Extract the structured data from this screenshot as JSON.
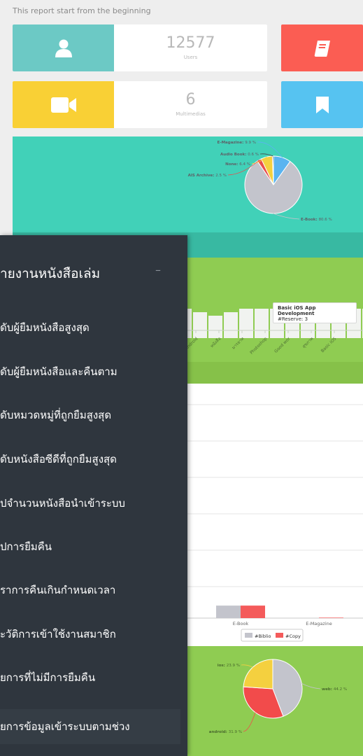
{
  "report": {
    "subtitle": "This report start from the beginning"
  },
  "stats": [
    {
      "value": "12577",
      "label": "Users",
      "icon": "user-icon",
      "color": "#6cc9c5"
    },
    {
      "value": "",
      "label": "",
      "icon": "book-icon",
      "color": "#fb5d53"
    },
    {
      "value": "6",
      "label": "Multimedias",
      "icon": "video-camera-icon",
      "color": "#f9d035"
    },
    {
      "value": "",
      "label": "",
      "icon": "bookmark-icon",
      "color": "#56c3f1"
    }
  ],
  "chart_data": [
    {
      "type": "pie",
      "categories": [
        "E-Book",
        "E-Magazine",
        "Audio Book",
        "None",
        "AIS Archive"
      ],
      "values": [
        80.6,
        9.9,
        0.6,
        6.4,
        2.5
      ],
      "labels": [
        "E-Book: 80.6 %",
        "E-Magazine: 9.9 %",
        "Audio Book: 0.6 %",
        "None: 6.4 %",
        "AIS Archive: 2.5 %"
      ],
      "colors": [
        "#c3c4cc",
        "#5ab4f0",
        "#444444",
        "#f4d03f",
        "#e84d4d"
      ]
    },
    {
      "type": "bar",
      "categories": [
        "Android",
        "หนังสือ",
        "มารยาท",
        "Photoshop",
        "Good wor",
        "สุขภาพ",
        "Basic iOS"
      ],
      "x_tick_labels": [
        "Android",
        "หนังสือ",
        "มารยาท",
        "Photoshop",
        "Good wor",
        "สุขภาพ",
        "Basic iOS"
      ],
      "tooltip": {
        "title": "Basic iOS App Development",
        "text": "#Reserve: 3"
      }
    },
    {
      "type": "bar",
      "categories": [
        "E-Book",
        "E-Magazine"
      ],
      "series": [
        {
          "name": "#Biblio",
          "values": [
            8,
            0
          ],
          "color": "#c3c4cc"
        },
        {
          "name": "#Copy",
          "values": [
            8,
            0.3
          ],
          "color": "#f45b5b"
        }
      ],
      "legend": "bottom-center"
    },
    {
      "type": "pie",
      "categories": [
        "web",
        "android",
        "ios"
      ],
      "values": [
        44.2,
        31.9,
        23.9
      ],
      "labels": [
        "web: 44.2 %",
        "android: 31.9 %",
        "ios: 23.9 %"
      ],
      "colors": [
        "#c3c4cc",
        "#f24b4b",
        "#f4d03f"
      ]
    }
  ],
  "menu": {
    "title": "ายงานหนังสือเล่ม",
    "collapse": "–",
    "items": [
      "ดับผู้ยืมหนังสือสูงสุด",
      "ดับผู้ยืมหนังสือและคืนตาม",
      "ดับหมวดหมู่ที่ถูกยืมสูงสุด",
      "ดับหนังสือซีดีที่ถูกยืมสูงสุด",
      "ปจำนวนหนังสือนำเข้าระบบ",
      "ปการยืมคืน",
      "ราการคืนเกินกำหนดเวลา",
      "ะวัติการเข้าใช้งานสมาชิก",
      "ยการที่ไม่มีการยืมคืน",
      "ยการข้อมูลเข้าระบบตามช่วง"
    ]
  }
}
